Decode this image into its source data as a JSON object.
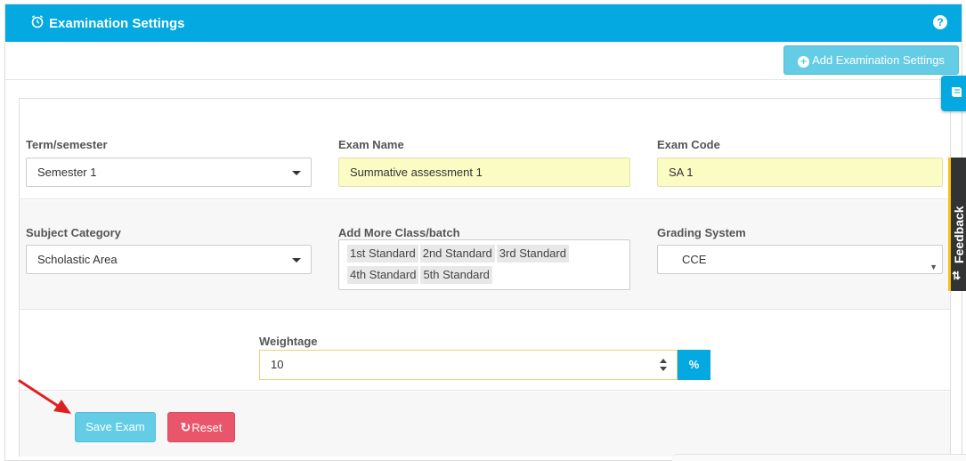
{
  "header": {
    "title": "Examination Settings",
    "help_icon": "?"
  },
  "toolbar": {
    "add_label": "Add Examination Settings"
  },
  "form": {
    "term": {
      "label": "Term/semester",
      "value": "Semester 1"
    },
    "exam_name": {
      "label": "Exam Name",
      "value": "Summative assessment 1"
    },
    "exam_code": {
      "label": "Exam Code",
      "value": "SA 1"
    },
    "subject_category": {
      "label": "Subject Category",
      "value": "Scholastic Area"
    },
    "classes": {
      "label": "Add More Class/batch",
      "items": [
        "1st Standard",
        "2nd Standard",
        "3rd Standard",
        "4th Standard",
        "5th Standard"
      ]
    },
    "grading": {
      "label": "Grading System",
      "value": "CCE"
    },
    "weightage": {
      "label": "Weightage",
      "value": "10",
      "unit": "%"
    }
  },
  "actions": {
    "save_label": "Save Exam",
    "reset_label": "Reset"
  },
  "side": {
    "feedback_label": "Feedback"
  },
  "icons": {
    "header": "alarm-clock-icon",
    "add": "plus-circle-icon",
    "reset": "refresh-icon",
    "side_tab": "book-icon"
  },
  "colors": {
    "primary": "#03a9e0",
    "info_button": "#64cde5",
    "danger_button": "#e9556b",
    "highlight_field": "#fbfbc4",
    "feedback_accent": "#f3c20f"
  }
}
